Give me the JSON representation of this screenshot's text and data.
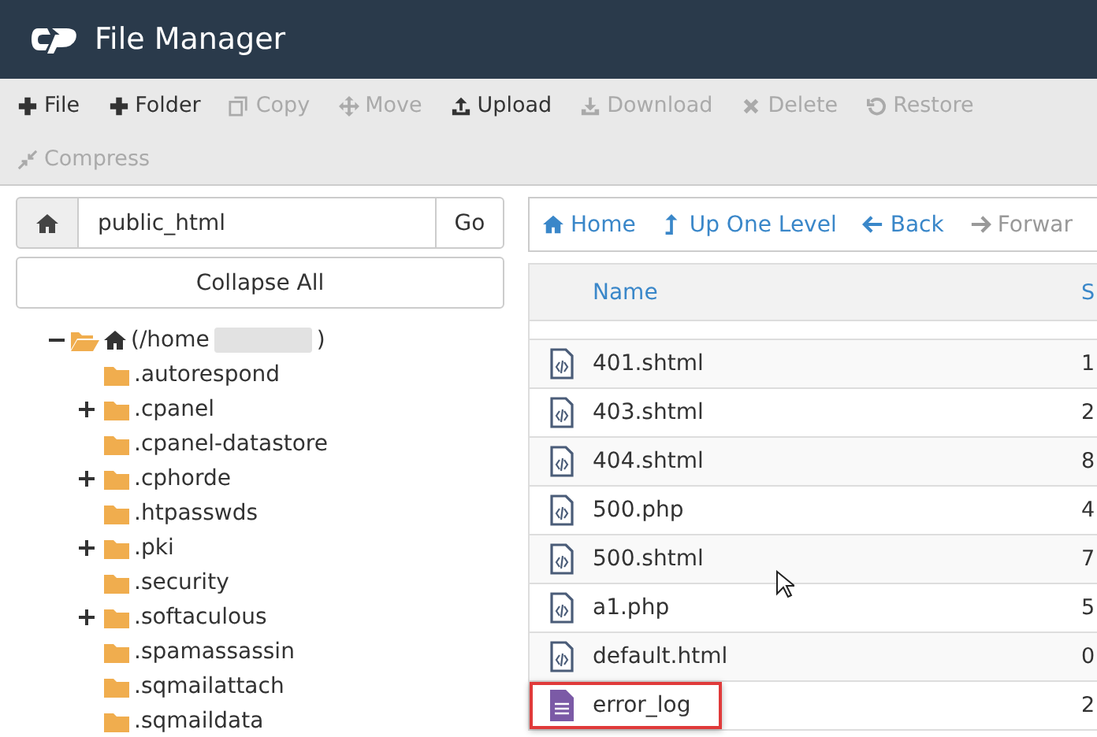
{
  "header": {
    "title": "File Manager"
  },
  "toolbar": [
    {
      "label": "File",
      "kind": "plus",
      "disabled": false
    },
    {
      "label": "Folder",
      "kind": "plus",
      "disabled": false
    },
    {
      "label": "Copy",
      "kind": "copy",
      "disabled": true
    },
    {
      "label": "Move",
      "kind": "move",
      "disabled": true
    },
    {
      "label": "Upload",
      "kind": "upload",
      "disabled": false
    },
    {
      "label": "Download",
      "kind": "download",
      "disabled": true
    },
    {
      "label": "Delete",
      "kind": "delete",
      "disabled": true
    },
    {
      "label": "Restore",
      "kind": "restore",
      "disabled": true
    },
    {
      "label": "Compress",
      "kind": "compress",
      "disabled": true
    }
  ],
  "path_bar": {
    "value": "public_html",
    "go": "Go"
  },
  "collapse_all": "Collapse All",
  "tree": {
    "label_start": "(/home",
    "label_end": ")",
    "expanded": true,
    "children": [
      {
        "label": ".autorespond",
        "kind": "leaf"
      },
      {
        "label": ".cpanel",
        "kind": "collapsed"
      },
      {
        "label": ".cpanel-datastore",
        "kind": "leaf"
      },
      {
        "label": ".cphorde",
        "kind": "collapsed"
      },
      {
        "label": ".htpasswds",
        "kind": "leaf"
      },
      {
        "label": ".pki",
        "kind": "collapsed"
      },
      {
        "label": ".security",
        "kind": "leaf"
      },
      {
        "label": ".softaculous",
        "kind": "collapsed"
      },
      {
        "label": ".spamassassin",
        "kind": "leaf"
      },
      {
        "label": ".sqmailattach",
        "kind": "leaf"
      },
      {
        "label": ".sqmaildata",
        "kind": "leaf"
      }
    ]
  },
  "nav": [
    {
      "label": "Home",
      "kind": "home",
      "disabled": false
    },
    {
      "label": "Up One Level",
      "kind": "up",
      "disabled": false
    },
    {
      "label": "Back",
      "kind": "back",
      "disabled": false
    },
    {
      "label": "Forwar",
      "kind": "forward",
      "disabled": true
    }
  ],
  "table": {
    "columns": [
      "Name",
      "S"
    ],
    "rows": [
      {
        "name": "401.shtml",
        "size": "1",
        "kind": "code",
        "highlighted": false
      },
      {
        "name": "403.shtml",
        "size": "2",
        "kind": "code",
        "highlighted": false
      },
      {
        "name": "404.shtml",
        "size": "8",
        "kind": "code",
        "highlighted": false
      },
      {
        "name": "500.php",
        "size": "4",
        "kind": "code",
        "highlighted": false
      },
      {
        "name": "500.shtml",
        "size": "7",
        "kind": "code",
        "highlighted": false
      },
      {
        "name": "a1.php",
        "size": "5",
        "kind": "code",
        "highlighted": false
      },
      {
        "name": "default.html",
        "size": "0",
        "kind": "code",
        "highlighted": false
      },
      {
        "name": "error_log",
        "size": "2",
        "kind": "text",
        "highlighted": true
      }
    ]
  }
}
